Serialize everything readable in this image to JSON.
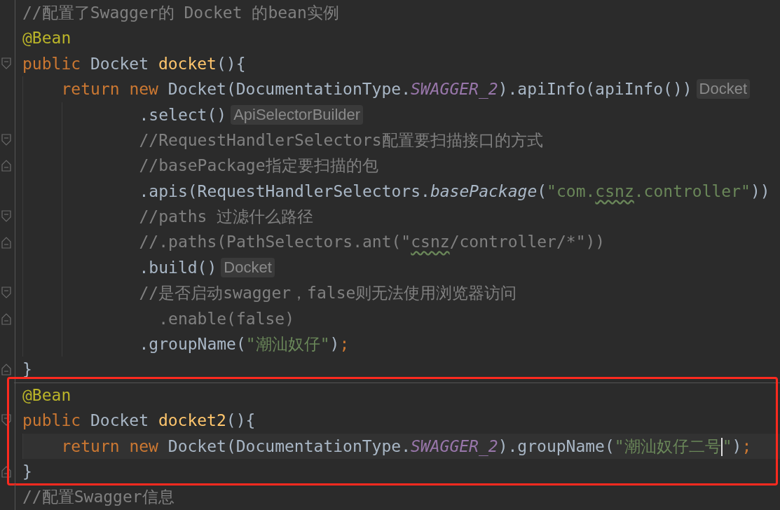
{
  "editor": {
    "groups": [
      {
        "highlighted": false,
        "separator": false,
        "lines": [
          {
            "current": false,
            "tokens": [
              {
                "kind": "comment",
                "text": "//配置了Swagger的 Docket 的bean实例"
              }
            ]
          },
          {
            "current": false,
            "tokens": [
              {
                "kind": "annotation",
                "text": "@Bean"
              }
            ]
          },
          {
            "current": false,
            "fold": {
              "kind": "start"
            },
            "tokens": [
              {
                "kind": "keyword",
                "text": "public"
              },
              {
                "kind": "plain",
                "text": " Docket "
              },
              {
                "kind": "method",
                "text": "docket"
              },
              {
                "kind": "plain",
                "text": "(){"
              }
            ],
            "children": [
              {
                "current": false,
                "tokens": [
                  {
                    "kind": "keyword",
                    "text": "return new"
                  },
                  {
                    "kind": "plain",
                    "text": " Docket(DocumentationType."
                  },
                  {
                    "kind": "constant",
                    "text": "SWAGGER_2"
                  },
                  {
                    "kind": "plain",
                    "text": ").apiInfo(apiInfo())"
                  }
                ],
                "hint": "Docket",
                "children": [
                  {
                    "current": false,
                    "kind": "chain",
                    "tokens": [
                      {
                        "kind": "plain",
                        "text": ".select()"
                      }
                    ],
                    "hint": "ApiSelectorBuilder"
                  },
                  {
                    "current": false,
                    "kind": "chain",
                    "fold": {
                      "kind": "start"
                    },
                    "tokens": [
                      {
                        "kind": "comment",
                        "text": "//RequestHandlerSelectors配置要扫描接口的方式"
                      }
                    ]
                  },
                  {
                    "current": false,
                    "kind": "chain",
                    "fold": {
                      "kind": "end"
                    },
                    "tokens": [
                      {
                        "kind": "comment",
                        "text": "//basePackage指定要扫描的包"
                      }
                    ]
                  },
                  {
                    "current": false,
                    "kind": "chain",
                    "tokens": [
                      {
                        "kind": "plain",
                        "text": ".apis(RequestHandlerSelectors."
                      },
                      {
                        "kind": "static",
                        "text": "basePackage"
                      },
                      {
                        "kind": "plain",
                        "text": "("
                      },
                      {
                        "kind": "string",
                        "text": "\"com."
                      },
                      {
                        "kind": "string_typo",
                        "text": "csnz"
                      },
                      {
                        "kind": "string",
                        "text": ".controller\""
                      },
                      {
                        "kind": "plain",
                        "text": "))"
                      }
                    ]
                  },
                  {
                    "current": false,
                    "kind": "chain",
                    "fold": {
                      "kind": "start"
                    },
                    "tokens": [
                      {
                        "kind": "comment",
                        "text": "//paths 过滤什么路径"
                      }
                    ]
                  },
                  {
                    "current": false,
                    "kind": "chain",
                    "fold": {
                      "kind": "end"
                    },
                    "tokens": [
                      {
                        "kind": "comment",
                        "text": "//.paths(PathSelectors.ant(\""
                      },
                      {
                        "kind": "comment_typo",
                        "text": "csnz"
                      },
                      {
                        "kind": "comment",
                        "text": "/controller/*\"))"
                      }
                    ]
                  },
                  {
                    "current": false,
                    "kind": "chain",
                    "tokens": [
                      {
                        "kind": "plain",
                        "text": ".build()"
                      }
                    ],
                    "hint": "Docket"
                  },
                  {
                    "current": false,
                    "kind": "chain",
                    "fold": {
                      "kind": "start"
                    },
                    "tokens": [
                      {
                        "kind": "comment",
                        "text": "//是否启动swagger，false则无法使用浏览器访问"
                      }
                    ]
                  },
                  {
                    "current": false,
                    "kind": "chain",
                    "fold": {
                      "kind": "end"
                    },
                    "tokens": [
                      {
                        "kind": "comment",
                        "text": "  .enable(false)"
                      }
                    ]
                  },
                  {
                    "current": false,
                    "kind": "chain",
                    "tokens": [
                      {
                        "kind": "plain",
                        "text": ".groupName("
                      },
                      {
                        "kind": "string",
                        "text": "\"潮汕奴仔\""
                      },
                      {
                        "kind": "plain",
                        "text": ")"
                      },
                      {
                        "kind": "punct",
                        "text": ";"
                      }
                    ]
                  }
                ]
              }
            ]
          },
          {
            "current": false,
            "fold": {
              "kind": "end"
            },
            "tokens": [
              {
                "kind": "plain",
                "text": "}"
              }
            ]
          }
        ]
      },
      {
        "highlighted": true,
        "separator": true,
        "lines": [
          {
            "current": false,
            "tokens": [
              {
                "kind": "annotation",
                "text": "@Bean"
              }
            ]
          },
          {
            "current": false,
            "fold": {
              "kind": "start"
            },
            "tokens": [
              {
                "kind": "keyword",
                "text": "public"
              },
              {
                "kind": "plain",
                "text": " Docket "
              },
              {
                "kind": "method",
                "text": "docket2"
              },
              {
                "kind": "plain",
                "text": "(){"
              }
            ],
            "children": [
              {
                "current": true,
                "tokens": [
                  {
                    "kind": "keyword",
                    "text": "return new"
                  },
                  {
                    "kind": "plain",
                    "text": " Docket(DocumentationType."
                  },
                  {
                    "kind": "constant",
                    "text": "SWAGGER_2"
                  },
                  {
                    "kind": "plain",
                    "text": ").groupName("
                  },
                  {
                    "kind": "string_caret",
                    "text": "\"潮汕奴仔二号"
                  },
                  {
                    "kind": "string",
                    "text": "\""
                  },
                  {
                    "kind": "plain",
                    "text": ")"
                  },
                  {
                    "kind": "punct",
                    "text": ";"
                  }
                ]
              }
            ]
          },
          {
            "current": false,
            "fold": {
              "kind": "end"
            },
            "tokens": [
              {
                "kind": "plain",
                "text": "}"
              }
            ]
          }
        ]
      },
      {
        "highlighted": false,
        "separator": false,
        "lines": [
          {
            "current": false,
            "tokens": [
              {
                "kind": "comment",
                "text": "//配置Swagger信息"
              }
            ]
          }
        ]
      }
    ]
  }
}
